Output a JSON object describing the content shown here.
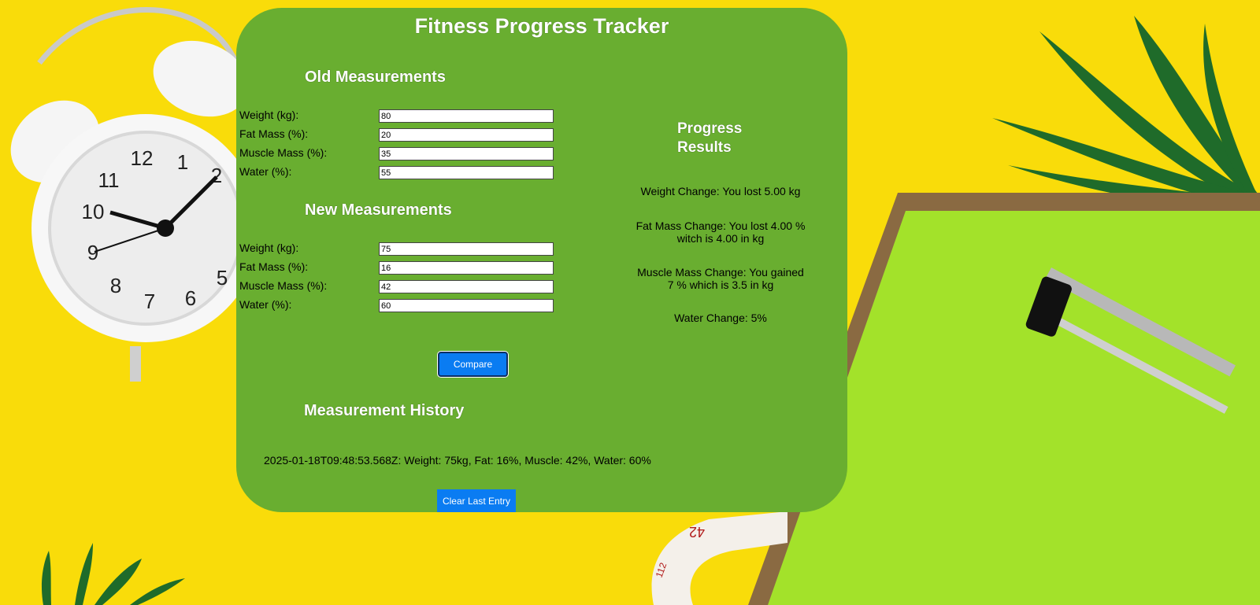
{
  "app": {
    "title": "Fitness Progress Tracker"
  },
  "old_measurements": {
    "heading": "Old Measurements",
    "fields": [
      {
        "label": "Weight (kg):",
        "value": "80"
      },
      {
        "label": "Fat Mass (%):",
        "value": "20"
      },
      {
        "label": "Muscle Mass (%):",
        "value": "35"
      },
      {
        "label": "Water (%):",
        "value": "55"
      }
    ]
  },
  "new_measurements": {
    "heading": "New Measurements",
    "fields": [
      {
        "label": "Weight (kg):",
        "value": "75"
      },
      {
        "label": "Fat Mass (%):",
        "value": "16"
      },
      {
        "label": "Muscle Mass (%):",
        "value": "42"
      },
      {
        "label": "Water (%):",
        "value": "60"
      }
    ]
  },
  "actions": {
    "compare_label": "Compare",
    "clear_label": "Clear Last Entry"
  },
  "results": {
    "heading": "Progress Results",
    "weight_change": "Weight Change: You lost 5.00 kg",
    "fat_change": "Fat Mass Change: You lost 4.00 % witch is 4.00 in kg",
    "muscle_change": "Muscle Mass Change: You gained 7 % which is 3.5 in kg",
    "water_change": "Water Change: 5%"
  },
  "history": {
    "heading": "Measurement History",
    "entries": [
      "2025-01-18T09:48:53.568Z: Weight: 75kg, Fat: 16%, Muscle: 42%, Water: 60%"
    ]
  },
  "colors": {
    "page_background": "#f9dc0a",
    "panel": "#69ae30",
    "button": "#0a7cf2",
    "heading_text": "#ffffff"
  },
  "background_icons": [
    "alarm-clock-icon",
    "palm-leaf-icon",
    "clipboard-icon",
    "measuring-tape-icon"
  ]
}
